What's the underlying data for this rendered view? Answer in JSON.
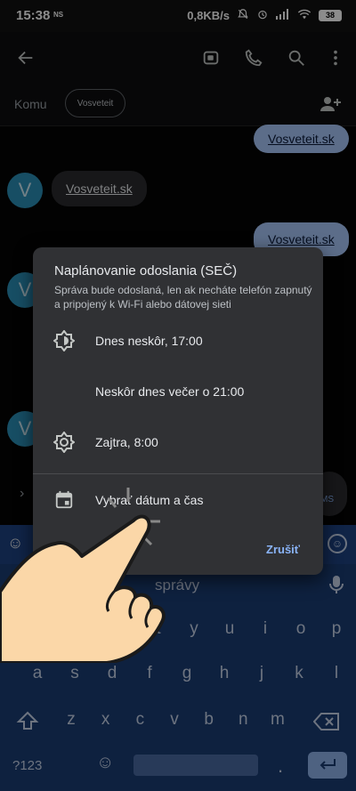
{
  "status_bar": {
    "time": "15:38",
    "ns": "NS",
    "speed": "0,8KB/s",
    "battery": "38"
  },
  "app_bar": {
    "back_icon": "arrow-back-icon",
    "actions": [
      "video-call-icon",
      "phone-icon",
      "search-icon",
      "more-vert-icon"
    ]
  },
  "recipients": {
    "label": "Komu",
    "chip": "Vosveteit",
    "add_icon": "add-person-icon"
  },
  "messages": {
    "out1": "Vosveteit.sk",
    "in1": "Vosveteit.sk",
    "out2": "Vosveteit.sk",
    "avatar_letter": "V"
  },
  "dialog": {
    "title": "Naplánovanie odoslania (SEČ)",
    "subtitle": "Správa bude odoslaná, len ak necháte telefón zapnutý a pripojený k Wi-Fi alebo dátovej sieti",
    "options": [
      {
        "label": "Dnes neskôr, 17:00",
        "icon": "brightness-icon"
      },
      {
        "label": "Neskôr dnes večer o 21:00",
        "icon": "moon-icon"
      },
      {
        "label": "Zajtra, 8:00",
        "icon": "sun-icon"
      },
      {
        "label": "Vybrať dátum a čas",
        "icon": "calendar-icon"
      }
    ],
    "cancel": "Zrušiť"
  },
  "compose": {
    "placeholder": "správy",
    "sms_label": "MS"
  },
  "keyboard": {
    "row1": [
      "e",
      "r",
      "t",
      "y",
      "u",
      "i",
      "o",
      "p"
    ],
    "row2": [
      "a",
      "s",
      "d",
      "f",
      "g",
      "h",
      "j",
      "k",
      "l"
    ],
    "row3": [
      "z",
      "x",
      "c",
      "v",
      "b",
      "n",
      "m"
    ],
    "symbols": "?123",
    "colors": {
      "bg": "#1b3c74",
      "key_text": "#c7d4ea",
      "enter": "#8fb3ec"
    }
  }
}
